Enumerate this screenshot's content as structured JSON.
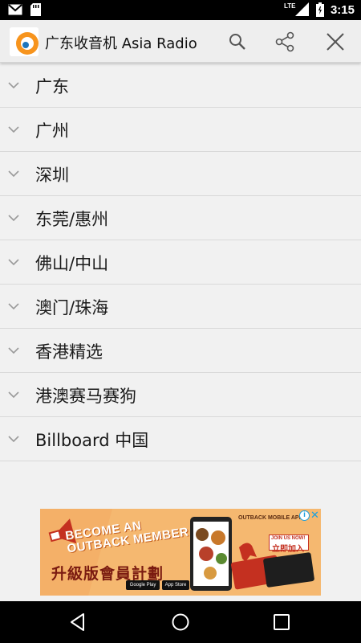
{
  "status_bar": {
    "network_label": "LTE",
    "time": "3:15"
  },
  "app_bar": {
    "title": "广东收音机 Asia Radio",
    "actions": [
      "search",
      "share",
      "close"
    ]
  },
  "categories": [
    {
      "label": "广东"
    },
    {
      "label": "广州"
    },
    {
      "label": "深圳"
    },
    {
      "label": "东莞/惠州"
    },
    {
      "label": "佛山/中山"
    },
    {
      "label": "澳门/珠海"
    },
    {
      "label": "香港精选"
    },
    {
      "label": "港澳赛马赛狗"
    },
    {
      "label": "Billboard 中国"
    }
  ],
  "ad": {
    "headline_line1": "BECOME AN",
    "headline_line2": "OUTBACK MEMBER",
    "cn_title": "升級版會員計劃",
    "member_app_text": "OUTBACK MOBILE APP",
    "join_en": "JOIN US NOW!",
    "join_cn": "立即加入",
    "store1": "Google Play",
    "store2": "App Store",
    "info_icon": "info-icon",
    "close_icon": "close-icon"
  },
  "colors": {
    "status_bar": "#000000",
    "app_bar": "#eeeeee",
    "list_bg": "#f1f1f1",
    "divider": "#d9d9d9",
    "ad_bg": "#f5b870",
    "nav_bar": "#000000"
  }
}
